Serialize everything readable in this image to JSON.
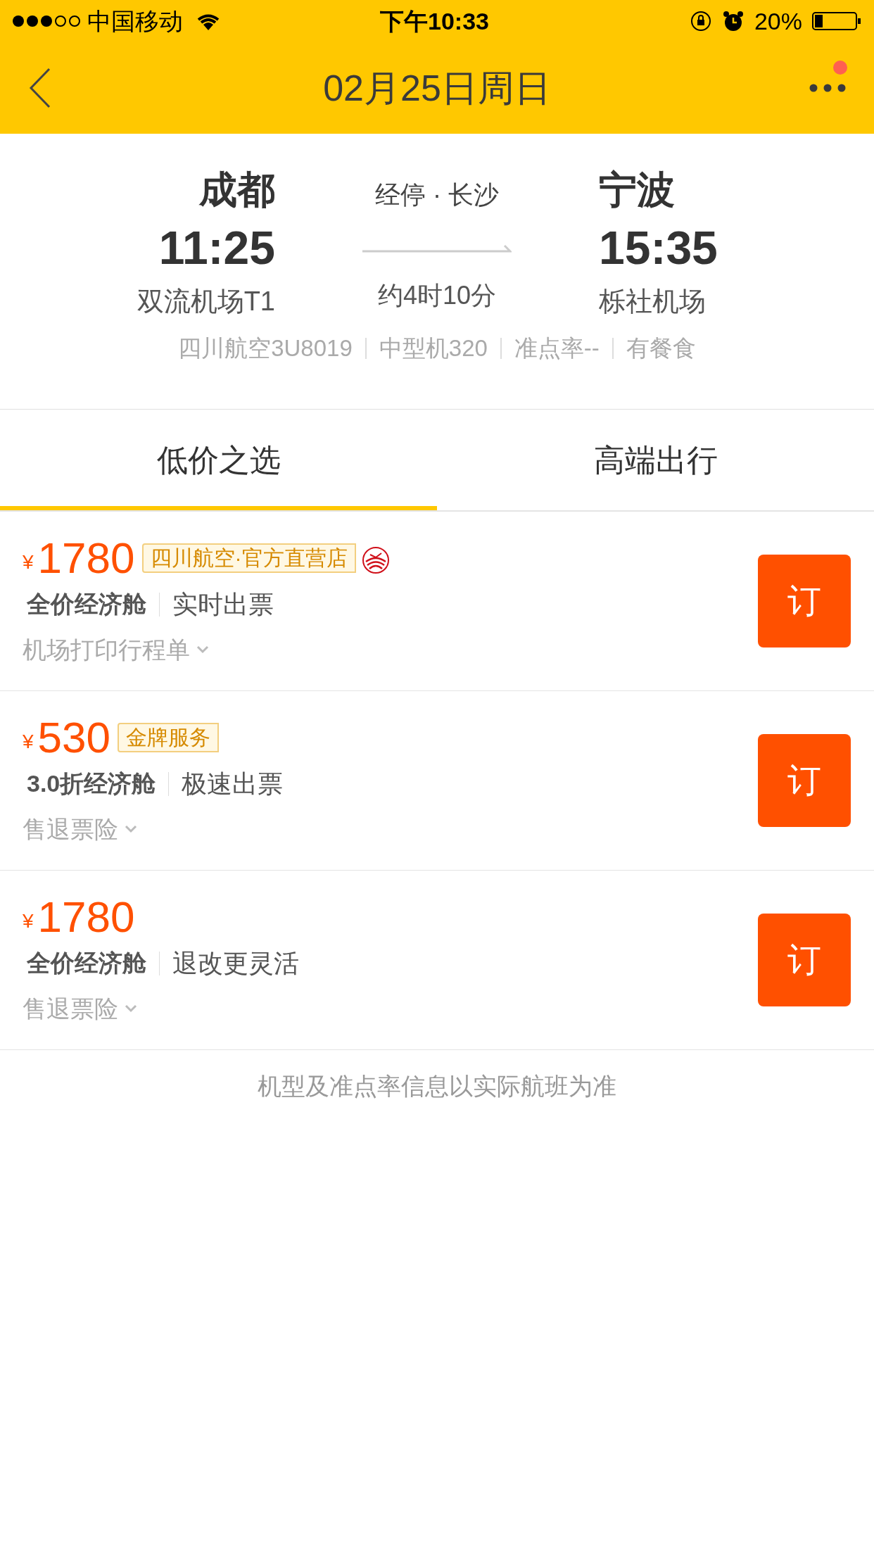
{
  "status_bar": {
    "carrier": "中国移动",
    "time": "下午10:33",
    "battery": "20%"
  },
  "header": {
    "title": "02月25日周日",
    "notification": true
  },
  "flight": {
    "from_city": "成都",
    "to_city": "宁波",
    "stopover": "经停 · 长沙",
    "depart_time": "11:25",
    "arrive_time": "15:35",
    "duration": "约4时10分",
    "from_airport": "双流机场T1",
    "to_airport": "栎社机场",
    "details": [
      "四川航空3U8019",
      "中型机320",
      "准点率--",
      "有餐食"
    ]
  },
  "tabs": [
    {
      "label": "低价之选",
      "selected": true
    },
    {
      "label": "高端出行",
      "selected": false
    }
  ],
  "offers": [
    {
      "currency": "¥",
      "price": "1780",
      "tag": "四川航空·官方直营店",
      "airline_logo": true,
      "cabin": "全价经济舱",
      "feature": "实时出票",
      "note": "机场打印行程单",
      "button": "订"
    },
    {
      "currency": "¥",
      "price": "530",
      "tag": "金牌服务",
      "airline_logo": false,
      "cabin": "3.0折经济舱",
      "feature": "极速出票",
      "note": "售退票险",
      "button": "订"
    },
    {
      "currency": "¥",
      "price": "1780",
      "airline_logo": false,
      "cabin": "全价经济舱",
      "feature": "退改更灵活",
      "note": "售退票险",
      "button": "订"
    }
  ],
  "footer_note": "机型及准点率信息以实际航班为准"
}
